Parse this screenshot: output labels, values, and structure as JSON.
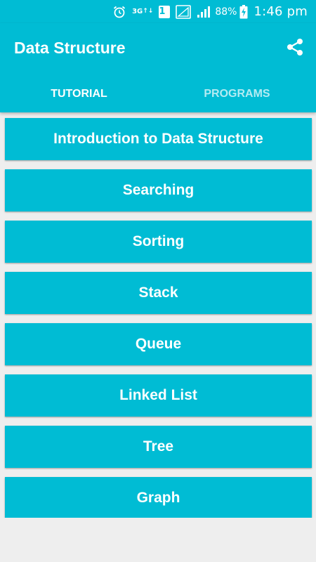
{
  "status_bar": {
    "network_label": "3G",
    "sim_badge": "1",
    "battery_percent": "88%",
    "time": "1:46 pm",
    "icons": [
      "alarm-icon",
      "network-3g-icon",
      "sim-badge",
      "signal-empty-icon",
      "signal-icon",
      "battery-charging-icon"
    ]
  },
  "app_bar": {
    "title": "Data Structure",
    "share_icon": "share-icon"
  },
  "tabs": [
    {
      "label": "TUTORIAL",
      "active": true
    },
    {
      "label": "PROGRAMS",
      "active": false
    }
  ],
  "topics": [
    {
      "label": "Introduction to Data Structure"
    },
    {
      "label": "Searching"
    },
    {
      "label": "Sorting"
    },
    {
      "label": "Stack"
    },
    {
      "label": "Queue"
    },
    {
      "label": "Linked List"
    },
    {
      "label": "Tree"
    },
    {
      "label": "Graph"
    }
  ],
  "colors": {
    "primary": "#00bcd4",
    "background": "#eeeeee",
    "text_on_primary": "#ffffff"
  }
}
